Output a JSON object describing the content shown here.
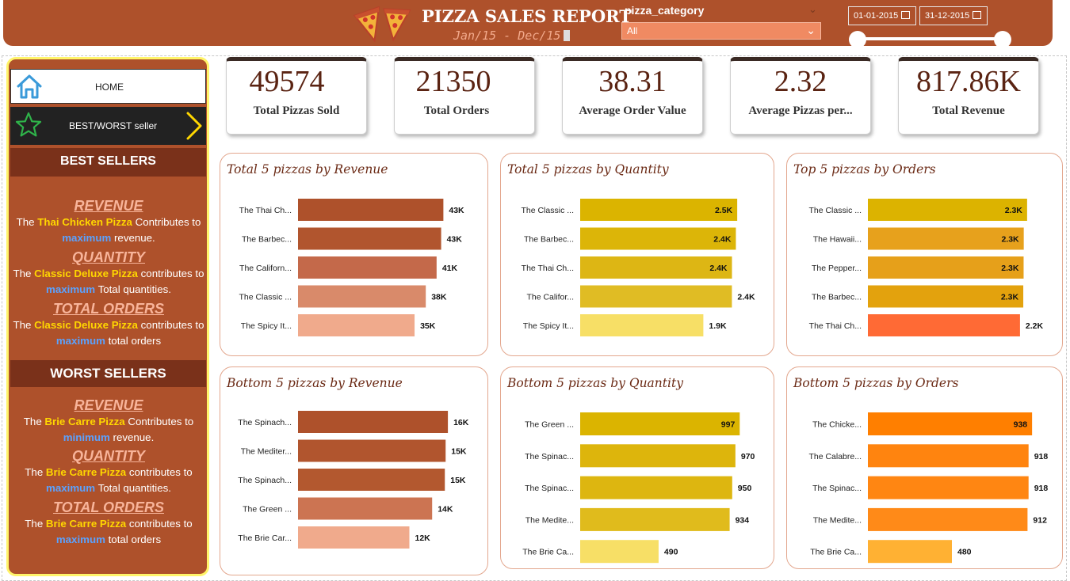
{
  "header": {
    "title": "PIZZA SALES REPORT",
    "subtitle": "Jan/15  - Dec/15",
    "filter_label": "pizza_category",
    "filter_value": "All",
    "date_start": "01-01-2015",
    "date_end": "31-12-2015"
  },
  "nav": {
    "home": "HOME",
    "best_worst": "BEST/WORST seller"
  },
  "best": {
    "title": "BEST SELLERS",
    "revenue": {
      "head": "REVENUE",
      "pre": "The ",
      "pizza": "Thai Chicken Pizza",
      "mid": " Contributes to ",
      "kw": "maximum",
      "post": " revenue."
    },
    "quantity": {
      "head": "QUANTITY",
      "pre": "The ",
      "pizza": "Classic Deluxe Pizza",
      "mid": " contributes to ",
      "kw": "maximum",
      "post": " Total quantities."
    },
    "orders": {
      "head": "TOTAL ORDERS",
      "pre": "The  ",
      "pizza": "Classic Deluxe Pizza",
      "mid": " contributes to ",
      "kw": "maximum",
      "post": " total orders"
    }
  },
  "worst": {
    "title": "WORST SELLERS",
    "revenue": {
      "head": "REVENUE",
      "pre": "The ",
      "pizza": "Brie Carre  Pizza",
      "mid": " Contributes to ",
      "kw": "minimum",
      "post": " revenue."
    },
    "quantity": {
      "head": "QUANTITY",
      "pre": "The ",
      "pizza": "Brie Carre Pizza",
      "mid": " contributes to ",
      "kw": "maximum",
      "post": " Total quantities."
    },
    "orders": {
      "head": "TOTAL ORDERS",
      "pre": "The  ",
      "pizza": "Brie Carre Pizza",
      "mid": "  contributes to ",
      "kw": "maximum",
      "post": " total orders"
    }
  },
  "kpis": [
    {
      "value": "49574",
      "label": "Total Pizzas Sold"
    },
    {
      "value": "21350",
      "label": "Total Orders"
    },
    {
      "value": "38.31",
      "label": "Average Order Value"
    },
    {
      "value": "2.32",
      "label": "Average Pizzas per..."
    },
    {
      "value": "817.86K",
      "label": "Total Revenue"
    }
  ],
  "chart_data": [
    {
      "type": "bar",
      "orientation": "horizontal",
      "title": "Total 5 pizzas by Revenue",
      "categories": [
        "The Thai Ch...",
        "The Barbec...",
        "The Californ...",
        "The Classic ...",
        "The Spicy It..."
      ],
      "values": [
        43434,
        42768,
        41410,
        38180,
        34831
      ],
      "labels": [
        "43K",
        "43K",
        "41K",
        "38K",
        "35K"
      ],
      "colors": [
        "#ae512b",
        "#b1552e",
        "#c4694a",
        "#d98a6a",
        "#f0aa8c"
      ],
      "xlim": [
        0,
        45000
      ]
    },
    {
      "type": "bar",
      "orientation": "horizontal",
      "title": "Total 5 pizzas by Quantity",
      "categories": [
        "The Classic ...",
        "The Barbec...",
        "The Thai Ch...",
        "The Califor...",
        "The Spicy It..."
      ],
      "values": [
        2453,
        2432,
        2371,
        2370,
        1924
      ],
      "labels": [
        "2.5K",
        "2.4K",
        "2.4K",
        "2.4K",
        "1.9K"
      ],
      "colors": [
        "#dbb400",
        "#dcb508",
        "#ddb614",
        "#e0bc24",
        "#f7df66"
      ],
      "xlim": [
        0,
        2600
      ]
    },
    {
      "type": "bar",
      "orientation": "horizontal",
      "title": "Top 5 pizzas by Orders",
      "categories": [
        "The Classic ...",
        "The Hawaii...",
        "The Pepper...",
        "The Barbec...",
        "The Thai Ch..."
      ],
      "values": [
        2329,
        2280,
        2278,
        2273,
        2225
      ],
      "labels": [
        "2.3K",
        "2.3K",
        "2.3K",
        "2.3K",
        "2.2K"
      ],
      "colors": [
        "#dcb300",
        "#e7a11c",
        "#e6a01a",
        "#e3a20d",
        "#ff6a35"
      ],
      "xlim": [
        0,
        2400
      ]
    },
    {
      "type": "bar",
      "orientation": "horizontal",
      "title": "Bottom 5 pizzas by Revenue",
      "categories": [
        "The Spinach...",
        "The Mediter...",
        "The Spinach...",
        "The Green ...",
        "The Brie Car..."
      ],
      "values": [
        15596,
        15360,
        15278,
        13956,
        11588
      ],
      "labels": [
        "16K",
        "15K",
        "15K",
        "14K",
        "12K"
      ],
      "colors": [
        "#ae512b",
        "#b1552e",
        "#b3582f",
        "#cc7452",
        "#f0aa8c"
      ],
      "xlim": [
        0,
        16000
      ]
    },
    {
      "type": "bar",
      "orientation": "horizontal",
      "title": "Bottom 5 pizzas by Quantity",
      "categories": [
        "The Green ...",
        "The Spinac...",
        "The Spinac...",
        "The Medite...",
        "The Brie Ca..."
      ],
      "values": [
        997,
        970,
        950,
        934,
        490
      ],
      "labels": [
        "997",
        "970",
        "950",
        "934",
        "490"
      ],
      "colors": [
        "#dbb400",
        "#ddb50c",
        "#ddb610",
        "#e0bb1c",
        "#f7df66"
      ],
      "xlim": [
        0,
        1050
      ]
    },
    {
      "type": "bar",
      "orientation": "horizontal",
      "title": "Bottom 5 pizzas by Orders",
      "categories": [
        "The Chicke...",
        "The Calabre...",
        "The Spinac...",
        "The Medite...",
        "The Brie Ca..."
      ],
      "values": [
        938,
        918,
        918,
        912,
        480
      ],
      "labels": [
        "938",
        "918",
        "918",
        "912",
        "480"
      ],
      "colors": [
        "#ff7f00",
        "#ff840f",
        "#ff8612",
        "#ff8a18",
        "#ffb133"
      ],
      "xlim": [
        0,
        960
      ]
    }
  ]
}
